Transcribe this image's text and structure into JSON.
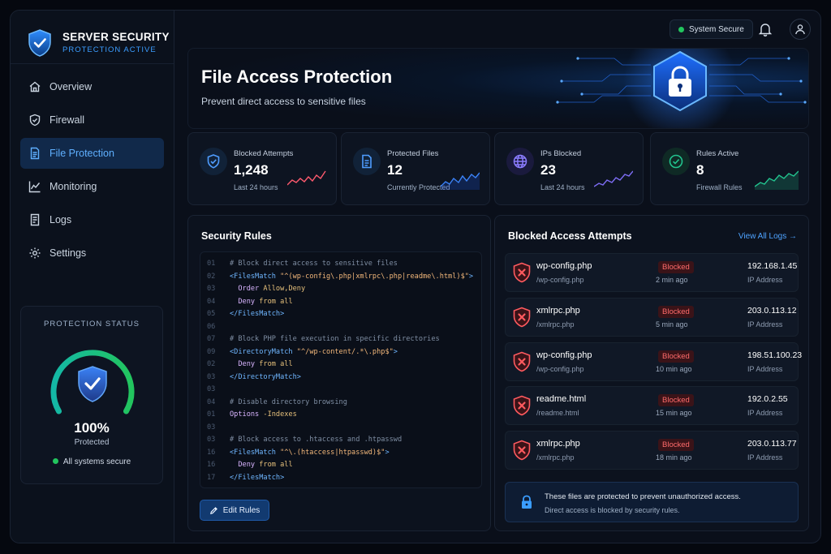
{
  "colors": {
    "accent": "#3b9dff",
    "danger": "#ff5a5f",
    "success": "#22c55e",
    "comment": "#7f8ea3",
    "tag": "#6fb6ff",
    "string": "#f2b77a",
    "keyword": "#d8b4fe",
    "value": "#e6c07b"
  },
  "brand": {
    "title": "SERVER SECURITY",
    "subtitle": "PROTECTION ACTIVE",
    "icon": "shield-check-icon"
  },
  "nav": [
    {
      "label": "Overview",
      "icon": "home-icon",
      "active": false
    },
    {
      "label": "Firewall",
      "icon": "shield-icon",
      "active": false
    },
    {
      "label": "File Protection",
      "icon": "file-icon",
      "active": true
    },
    {
      "label": "Monitoring",
      "icon": "chart-icon",
      "active": false
    },
    {
      "label": "Logs",
      "icon": "log-icon",
      "active": false
    },
    {
      "label": "Settings",
      "icon": "gear-icon",
      "active": false
    }
  ],
  "status": {
    "title": "PROTECTION STATUS",
    "percent": "100%",
    "percent_value": 100,
    "label": "Protected",
    "secure_text": "All systems secure"
  },
  "topbar": {
    "system_status": "System Secure",
    "bell_icon": "bell-icon",
    "user_icon": "user-icon"
  },
  "hero": {
    "title": "File Access Protection",
    "subtitle": "Prevent direct access to sensitive files",
    "art_icon": "lock-icon"
  },
  "stats": [
    {
      "label": "Blocked Attempts",
      "value": "1,248",
      "sub": "Last 24 hours",
      "icon": "shield-check-icon",
      "color": "#ff5a6e"
    },
    {
      "label": "Protected Files",
      "value": "12",
      "sub": "Currently Protected",
      "icon": "document-icon",
      "color": "#3b82f6"
    },
    {
      "label": "IPs Blocked",
      "value": "23",
      "sub": "Last 24 hours",
      "icon": "globe-icon",
      "color": "#7c6cf2"
    },
    {
      "label": "Rules Active",
      "value": "8",
      "sub": "Firewall Rules",
      "icon": "check-circle-icon",
      "color": "#22c38e"
    }
  ],
  "rules": {
    "title": "Security Rules",
    "edit_label": "Edit Rules",
    "lines": [
      {
        "no": "01",
        "segs": [
          [
            "comment",
            "# Block direct access to sensitive files"
          ]
        ]
      },
      {
        "no": "02",
        "segs": [
          [
            "tag",
            "<FilesMatch "
          ],
          [
            "string",
            "\"^(wp-config\\.php|xmlrpc\\.php|readme\\.html)$\""
          ],
          [
            "tag",
            ">"
          ]
        ]
      },
      {
        "no": "03",
        "segs": [
          [
            "plain",
            "  "
          ],
          [
            "keyword",
            "Order "
          ],
          [
            "value",
            "Allow,Deny"
          ]
        ]
      },
      {
        "no": "04",
        "segs": [
          [
            "plain",
            "  "
          ],
          [
            "keyword",
            "Deny "
          ],
          [
            "value",
            "from all"
          ]
        ]
      },
      {
        "no": "05",
        "segs": [
          [
            "tag",
            "</FilesMatch>"
          ]
        ]
      },
      {
        "no": "06",
        "segs": []
      },
      {
        "no": "07",
        "segs": [
          [
            "comment",
            "# Block PHP file execution in specific directories"
          ]
        ]
      },
      {
        "no": "09",
        "segs": [
          [
            "tag",
            "<DirectoryMatch "
          ],
          [
            "string",
            "\"^/wp-content/.*\\.php$\""
          ],
          [
            "tag",
            ">"
          ]
        ]
      },
      {
        "no": "02",
        "segs": [
          [
            "plain",
            "  "
          ],
          [
            "keyword",
            "Deny "
          ],
          [
            "value",
            "from all"
          ]
        ]
      },
      {
        "no": "03",
        "segs": [
          [
            "tag",
            "</DirectoryMatch>"
          ]
        ]
      },
      {
        "no": "03",
        "segs": []
      },
      {
        "no": "04",
        "segs": [
          [
            "comment",
            "# Disable directory browsing"
          ]
        ]
      },
      {
        "no": "01",
        "segs": [
          [
            "keyword",
            "Options "
          ],
          [
            "value",
            "-Indexes"
          ]
        ]
      },
      {
        "no": "03",
        "segs": []
      },
      {
        "no": "03",
        "segs": [
          [
            "comment",
            "# Block access to .htaccess and .htpasswd"
          ]
        ]
      },
      {
        "no": "16",
        "segs": [
          [
            "tag",
            "<FilesMatch "
          ],
          [
            "string",
            "\"^\\.(htaccess|htpasswd)$\""
          ],
          [
            "tag",
            ">"
          ]
        ]
      },
      {
        "no": "16",
        "segs": [
          [
            "plain",
            "  "
          ],
          [
            "keyword",
            "Deny "
          ],
          [
            "value",
            "from all"
          ]
        ]
      },
      {
        "no": "17",
        "segs": [
          [
            "tag",
            "</FilesMatch>"
          ]
        ]
      }
    ]
  },
  "attempts": {
    "title": "Blocked Access Attempts",
    "view_all": "View All Logs →",
    "rows": [
      {
        "file": "wp-config.php",
        "path": "/wp-config.php",
        "status": "Blocked",
        "time": "2 min ago",
        "ip": "192.168.1.45",
        "ip_label": "IP Address"
      },
      {
        "file": "xmlrpc.php",
        "path": "/xmlrpc.php",
        "status": "Blocked",
        "time": "5 min ago",
        "ip": "203.0.113.12",
        "ip_label": "IP Address"
      },
      {
        "file": "wp-config.php",
        "path": "/wp-config.php",
        "status": "Blocked",
        "time": "10 min ago",
        "ip": "198.51.100.23",
        "ip_label": "IP Address"
      },
      {
        "file": "readme.html",
        "path": "/readme.html",
        "status": "Blocked",
        "time": "15 min ago",
        "ip": "192.0.2.55",
        "ip_label": "IP Address"
      },
      {
        "file": "xmlrpc.php",
        "path": "/xmlrpc.php",
        "status": "Blocked",
        "time": "18 min ago",
        "ip": "203.0.113.77",
        "ip_label": "IP Address"
      }
    ],
    "notice_line1": "These files are protected to prevent unauthorized access.",
    "notice_line2": "Direct access is blocked by security rules."
  }
}
